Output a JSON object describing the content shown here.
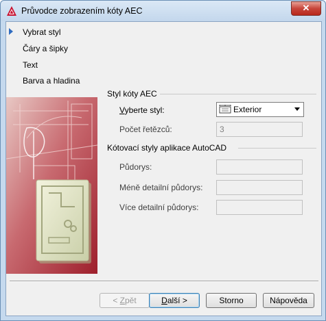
{
  "window": {
    "title": "Průvodce zobrazením kóty AEC",
    "close_glyph": "✕"
  },
  "steps": [
    {
      "label": "Vybrat styl",
      "active": true
    },
    {
      "label": "Čáry a šipky",
      "active": false
    },
    {
      "label": "Text",
      "active": false
    },
    {
      "label": "Barva a hladina",
      "active": false
    }
  ],
  "style_group": {
    "title": "Styl kóty AEC",
    "select_style_label_prefix": "V",
    "select_style_label_rest": "yberte styl:",
    "select_style_value": "Exterior",
    "chain_count_label": "Počet řetězců:",
    "chain_count_value": "3"
  },
  "autocad_group": {
    "title": "Kótovací styly aplikace AutoCAD",
    "floor_plan_label": "Půdorys:",
    "less_detail_label": "Méně detailní půdorys:",
    "more_detail_label": "Více detailní půdorys:"
  },
  "buttons": {
    "back_prefix": "< ",
    "back_underlined": "Z",
    "back_rest": "pět",
    "next_underlined": "D",
    "next_rest": "alší >",
    "cancel": "Storno",
    "help": "Nápověda"
  },
  "colors": {
    "accent": "#2f6cc0",
    "banner": "#b8404a"
  },
  "icons": {
    "app": "autocad-logo-icon",
    "close": "close-icon",
    "step_arrow": "arrow-right-icon",
    "style": "dimension-style-icon",
    "dropdown": "chevron-down-icon"
  }
}
